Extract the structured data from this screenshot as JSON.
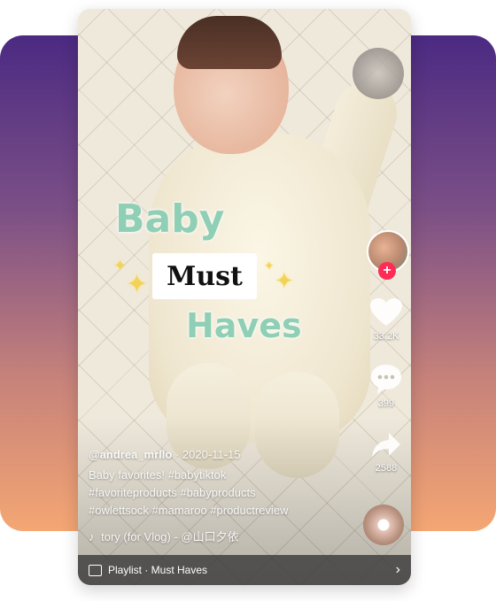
{
  "video": {
    "overlay_line1": "Baby",
    "overlay_line2": "Must",
    "overlay_line3": "Haves",
    "sparkle_glyph": "✦"
  },
  "sidebar": {
    "like_count": "33.2K",
    "comment_count": "399",
    "share_count": "2588",
    "follow_glyph": "+"
  },
  "caption": {
    "username": "@andrea_mrllo",
    "date": "· 2020-11-15",
    "line1": "Baby favorites! #babytiktok",
    "line2": "#favoriteproducts #babyproducts",
    "line3": "#owlettsock #mamaroo #productreview",
    "music": "tory (for Vlog) - @山口夕依",
    "music_glyph": "♪"
  },
  "playlist": {
    "label": "Playlist · Must Haves",
    "chevron": "›"
  },
  "colors": {
    "overlay_text": "#8fcfb5",
    "follow_badge": "#fe2c55",
    "gradient_top": "#4b2a82",
    "gradient_bottom": "#f4a673"
  }
}
